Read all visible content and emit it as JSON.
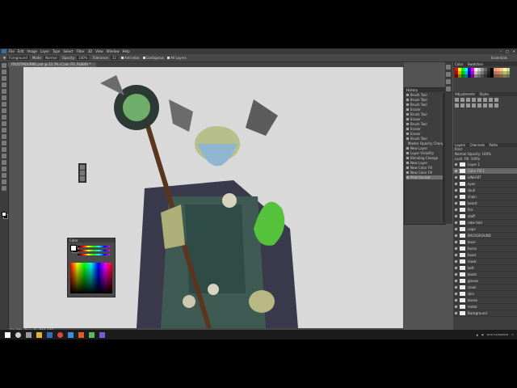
{
  "menu": {
    "items": [
      "File",
      "Edit",
      "Image",
      "Layer",
      "Type",
      "Select",
      "Filter",
      "3D",
      "View",
      "Window",
      "Help"
    ],
    "window_controls": [
      "–",
      "□",
      "✕"
    ]
  },
  "options": {
    "tool_preset": "Foreground",
    "mode_label": "Mode:",
    "mode_value": "Normal",
    "opacity_label": "Opacity:",
    "opacity_value": "100%",
    "tolerance_label": "Tolerance:",
    "tolerance_value": "32",
    "anti_alias": "Anti-alias",
    "contiguous": "Contiguous",
    "all_layers": "All Layers",
    "workspace": "Essentials"
  },
  "document": {
    "tab_title": "FROSTMOURNE.psd @ 33.3% (Color Fill, RGB/8) *",
    "zoom": "33.33%",
    "doc_info": "Doc: 41.2M/1.18G"
  },
  "color_panel": {
    "title": "Color"
  },
  "history": {
    "title": "History",
    "items": [
      "Brush Tool",
      "Brush Tool",
      "Brush Tool",
      "Eraser",
      "Brush Tool",
      "Eraser",
      "Brush Tool",
      "Eraser",
      "Eraser",
      "Brush Tool",
      "Master Opacity Change",
      "New Layer",
      "Layer Visibility",
      "Blending Change",
      "New Layer",
      "New Color Fill",
      "New Color Fill",
      "Paint Bucket"
    ],
    "selected_index": 17
  },
  "swatches": {
    "tabs": [
      "Color",
      "Swatches"
    ]
  },
  "adjustments": {
    "tabs": [
      "Adjustments",
      "Styles"
    ]
  },
  "layers": {
    "tabs": [
      "Layers",
      "Channels",
      "Paths"
    ],
    "kind": "Kind",
    "blend_mode": "Normal",
    "opacity_label": "Opacity:",
    "opacity_value": "100%",
    "lock_label": "Lock:",
    "fill_label": "Fill:",
    "fill_value": "100%",
    "items": [
      {
        "name": "Layer 1"
      },
      {
        "name": "Color Fill 1",
        "selected": true
      },
      {
        "name": "LINEART"
      },
      {
        "name": "eyes"
      },
      {
        "name": "skull"
      },
      {
        "name": "chain"
      },
      {
        "name": "beard"
      },
      {
        "name": "fire"
      },
      {
        "name": "staff"
      },
      {
        "name": "robe fold"
      },
      {
        "name": "cape"
      },
      {
        "name": "BACKGROUND"
      },
      {
        "name": "base"
      },
      {
        "name": "horns"
      },
      {
        "name": "hood"
      },
      {
        "name": "mask"
      },
      {
        "name": "belt"
      },
      {
        "name": "boots"
      },
      {
        "name": "gloves"
      },
      {
        "name": "cloak"
      },
      {
        "name": "skin"
      },
      {
        "name": "bones"
      },
      {
        "name": "metal"
      },
      {
        "name": "Background"
      }
    ]
  },
  "taskbar": {
    "time": "12:02",
    "date": "11/03/2019"
  }
}
